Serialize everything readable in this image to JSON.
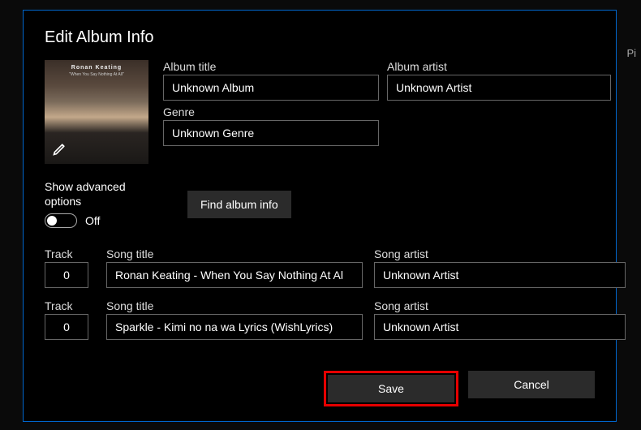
{
  "page_behind": "Pi",
  "dialog_title": "Edit Album Info",
  "album_art": {
    "line1": "Ronan Keating",
    "line2": "\"When You Say Nothing At All\""
  },
  "labels": {
    "album_title": "Album title",
    "album_artist": "Album artist",
    "genre": "Genre",
    "show_advanced": "Show advanced options",
    "toggle_off": "Off",
    "find_album": "Find album info",
    "track": "Track",
    "song_title": "Song title",
    "song_artist": "Song artist",
    "save": "Save",
    "cancel": "Cancel"
  },
  "values": {
    "album_title": "Unknown Album",
    "album_artist": "Unknown Artist",
    "genre": "Unknown Genre"
  },
  "tracks": [
    {
      "num": "0",
      "title": "Ronan Keating - When You Say Nothing At Al",
      "artist": "Unknown Artist"
    },
    {
      "num": "0",
      "title": "Sparkle - Kimi no na wa Lyrics (WishLyrics)",
      "artist": "Unknown Artist"
    }
  ]
}
